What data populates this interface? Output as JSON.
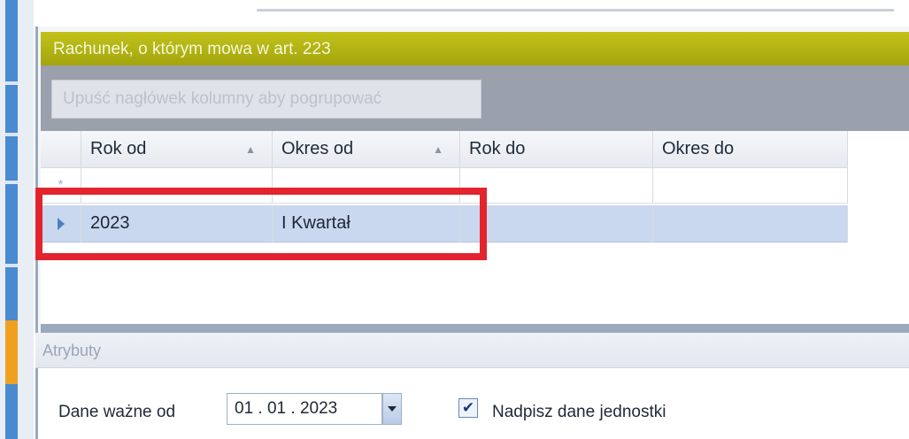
{
  "panel": {
    "title": "Rachunek, o którym mowa w art. 223"
  },
  "group_by_hint": "Upuść nagłówek kolumny aby pogrupować",
  "grid": {
    "columns": [
      "Rok od",
      "Okres od",
      "Rok do",
      "Okres do"
    ],
    "new_row_marker": "*",
    "rows": [
      {
        "rok_od": "2023",
        "okres_od": "I Kwartał",
        "rok_do": "",
        "okres_do": ""
      }
    ]
  },
  "attributes": {
    "title": "Atrybuty",
    "date_label": "Dane ważne od",
    "date_value": "01 . 01 . 2023",
    "checkbox_label": "Nadpisz dane jednostki",
    "checkbox_checked": true,
    "checkmark": "✔"
  },
  "colors": {
    "panel_header": "#b3b414",
    "highlight": "#e3232e",
    "selected_row": "#c9d8ee"
  }
}
